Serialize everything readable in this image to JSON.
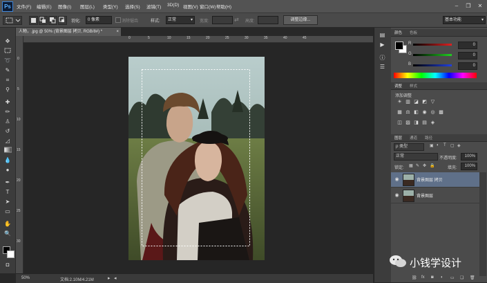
{
  "app": {
    "logo": "Ps"
  },
  "menu": [
    "文件(F)",
    "编辑(E)",
    "图像(I)",
    "图层(L)",
    "类型(Y)",
    "选择(S)",
    "滤镜(T)",
    "3D(D)",
    "视图(V)",
    "窗口(W)",
    "帮助(H)"
  ],
  "options": {
    "feather_label": "羽化:",
    "feather_value": "0 像素",
    "antialias_label": "消除锯齿",
    "style_label": "样式:",
    "style_value": "正常",
    "width_label": "宽度:",
    "height_label": "高度:",
    "refine_edge_button": "调整边缘...",
    "workspace_value": "基本功能"
  },
  "document": {
    "tab_title": "人物，.jpg @ 50% (背景图层 拷贝, RGB/8#) *",
    "close_glyph": "×",
    "ruler_top": [
      "0",
      "5",
      "10",
      "15",
      "20",
      "25",
      "30",
      "35",
      "40",
      "45"
    ],
    "ruler_left": [
      "0",
      "5",
      "10",
      "15",
      "20",
      "25",
      "30"
    ]
  },
  "status": {
    "zoom": "50%",
    "doc_info": "文档:2.10M/4.21M"
  },
  "color_panel": {
    "tabs": [
      "颜色",
      "色板"
    ],
    "rows": [
      {
        "label": "R",
        "value": "0",
        "color": "#d81e1e"
      },
      {
        "label": "G",
        "value": "0",
        "color": "#1ec81e"
      },
      {
        "label": "B",
        "value": "0",
        "color": "#1e3cd8"
      }
    ]
  },
  "adjustments_panel": {
    "tabs": [
      "调整",
      "样式"
    ],
    "title": "添加调整",
    "icons": [
      "brightness-icon",
      "levels-icon",
      "curves-icon",
      "exposure-icon",
      "vibrance-icon",
      "hue-saturation-icon",
      "color-balance-icon",
      "black-white-icon",
      "photo-filter-icon",
      "channel-mixer-icon",
      "color-lookup-icon",
      "invert-icon",
      "posterize-icon",
      "threshold-icon",
      "gradient-map-icon",
      "selective-color-icon"
    ],
    "icon_glyphs": [
      "☀",
      "▥",
      "◪",
      "◩",
      "▽",
      "▦",
      "⚖",
      "◧",
      "◉",
      "◎",
      "▩",
      "◫",
      "▨",
      "◨",
      "▤",
      "◈"
    ]
  },
  "layers_panel": {
    "tabs": [
      "图层",
      "通道",
      "路径"
    ],
    "filter_label": "ρ 类型",
    "blend_mode": "正常",
    "opacity_label": "不透明度:",
    "opacity_value": "100%",
    "lock_label": "锁定:",
    "fill_label": "填充:",
    "fill_value": "100%",
    "layers": [
      {
        "name": "背景图层 拷贝",
        "selected": true
      },
      {
        "name": "背景图层",
        "selected": false
      }
    ]
  },
  "watermark": {
    "text": "小钱学设计"
  }
}
